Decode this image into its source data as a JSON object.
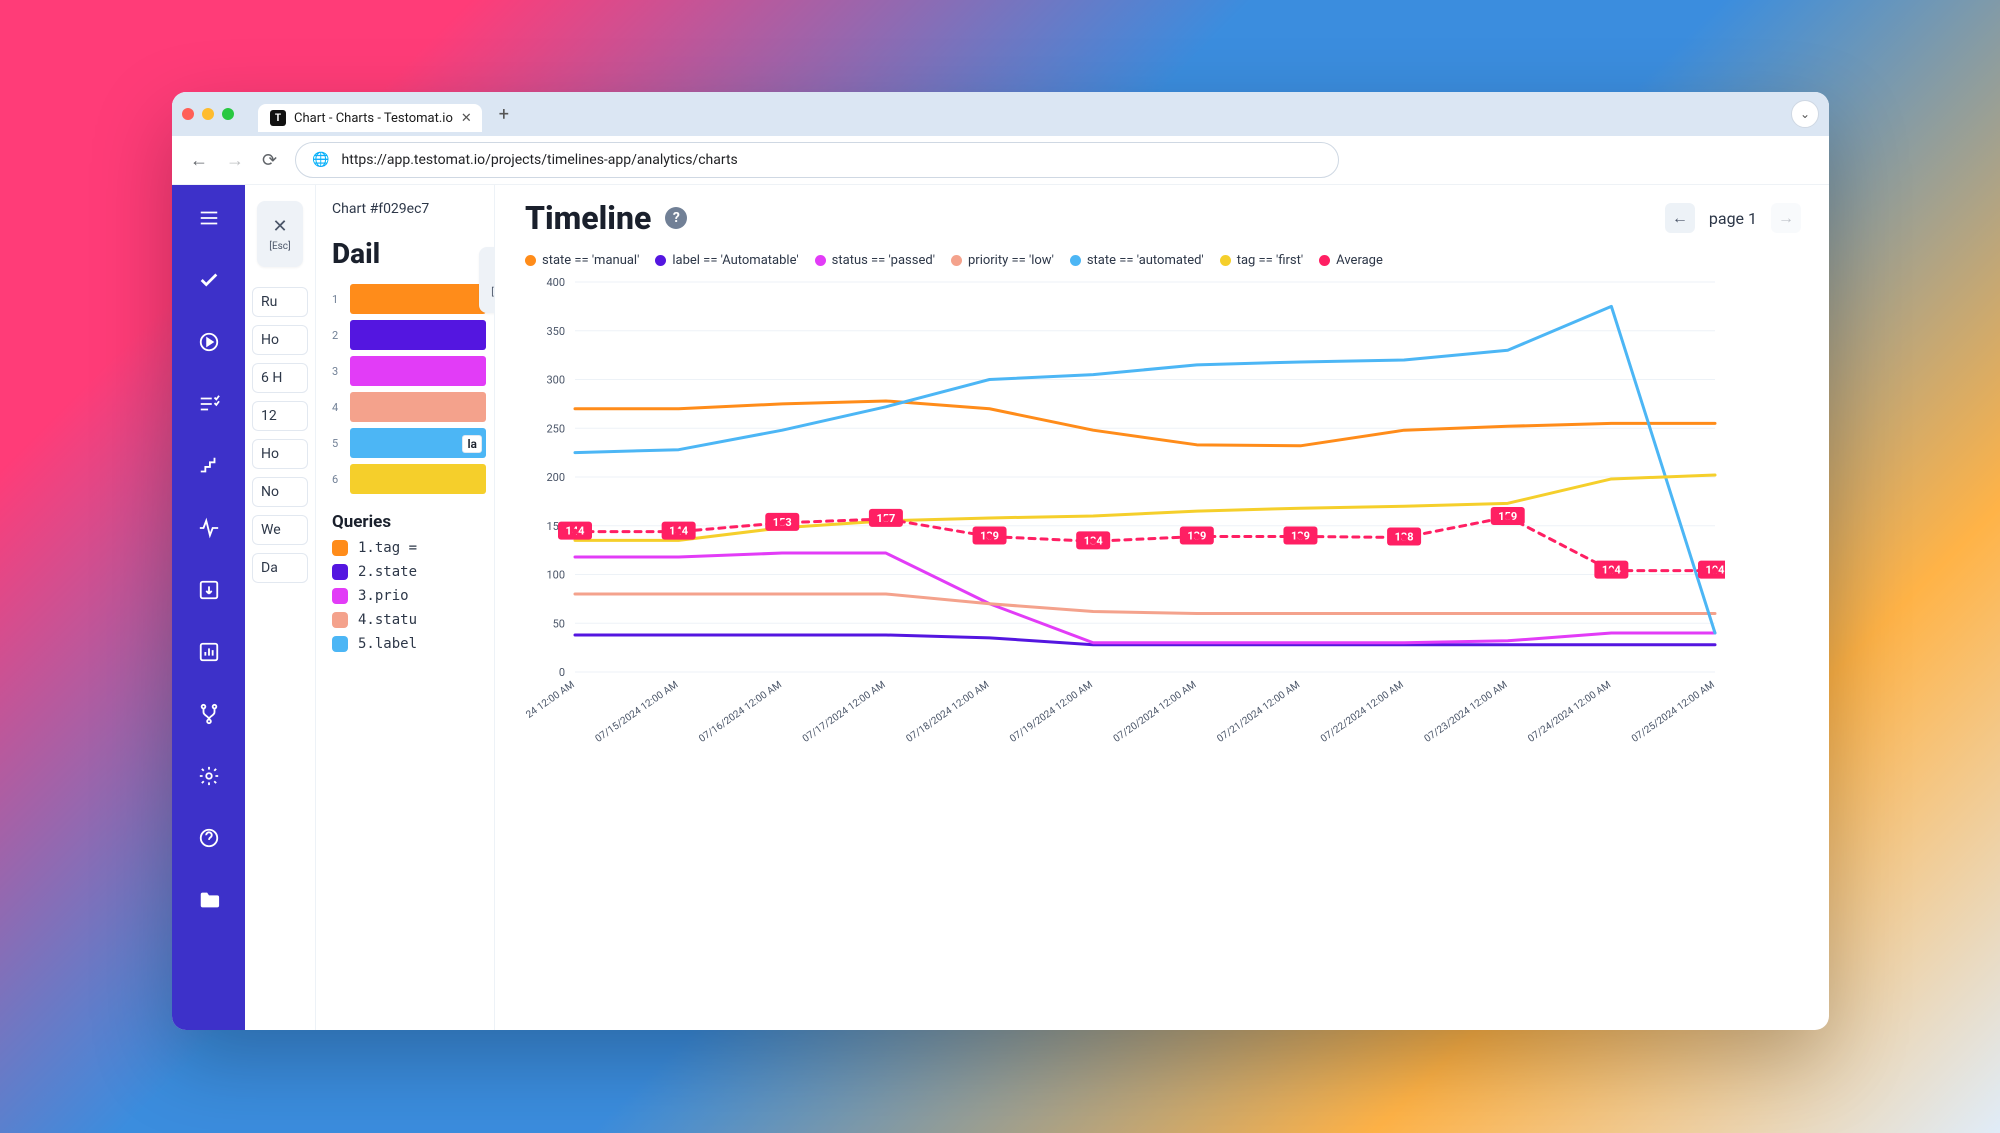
{
  "browser": {
    "tab_title": "Chart - Charts - Testomat.io",
    "url": "https://app.testomat.io/projects/timelines-app/analytics/charts"
  },
  "collapse": {
    "esc": "[Esc]"
  },
  "panel_chips": [
    "Ru",
    "Ho",
    "6 H",
    "12",
    "Ho",
    "No",
    "We",
    "Da"
  ],
  "mid": {
    "crumb": "Chart #f029ec7",
    "heading": "Dail",
    "swatches": [
      {
        "n": "1",
        "color": "#ff8c1a"
      },
      {
        "n": "2",
        "color": "#5416e0"
      },
      {
        "n": "3",
        "color": "#e23cf7"
      },
      {
        "n": "4",
        "color": "#f4a28c"
      },
      {
        "n": "5",
        "color": "#4cb6f5",
        "tag": "la"
      },
      {
        "n": "6",
        "color": "#f5cf2b"
      }
    ],
    "queries_title": "Queries",
    "queries": [
      {
        "color": "#ff8c1a",
        "text": "1.tag ="
      },
      {
        "color": "#5416e0",
        "text": "2.state"
      },
      {
        "color": "#e23cf7",
        "text": "3.prio"
      },
      {
        "color": "#f4a28c",
        "text": "4.statu"
      },
      {
        "color": "#4cb6f5",
        "text": "5.label"
      }
    ]
  },
  "header": {
    "title": "Timeline",
    "page": "page 1"
  },
  "legend": [
    {
      "color": "#ff8c1a",
      "label": "state == 'manual'"
    },
    {
      "color": "#5416e0",
      "label": "label == 'Automatable'"
    },
    {
      "color": "#e23cf7",
      "label": "status == 'passed'"
    },
    {
      "color": "#f4a28c",
      "label": "priority == 'low'"
    },
    {
      "color": "#4cb6f5",
      "label": "state == 'automated'"
    },
    {
      "color": "#f5cf2b",
      "label": "tag == 'first'"
    },
    {
      "color": "#ff1f63",
      "label": "Average"
    }
  ],
  "chart_data": {
    "type": "line",
    "title": "Timeline",
    "xlabel": "",
    "ylabel": "",
    "ylim": [
      0,
      400
    ],
    "y_ticks": [
      0,
      50,
      100,
      150,
      200,
      250,
      300,
      350,
      400
    ],
    "categories": [
      "24 12:00 AM",
      "07/15/2024 12:00 AM",
      "07/16/2024 12:00 AM",
      "07/17/2024 12:00 AM",
      "07/18/2024 12:00 AM",
      "07/19/2024 12:00 AM",
      "07/20/2024 12:00 AM",
      "07/21/2024 12:00 AM",
      "07/22/2024 12:00 AM",
      "07/23/2024 12:00 AM",
      "07/24/2024 12:00 AM",
      "07/25/2024 12:00 AM"
    ],
    "series": [
      {
        "name": "state == 'manual'",
        "color": "#ff8c1a",
        "values": [
          270,
          270,
          275,
          278,
          270,
          248,
          233,
          232,
          248,
          252,
          255,
          255
        ]
      },
      {
        "name": "label == 'Automatable'",
        "color": "#5416e0",
        "values": [
          38,
          38,
          38,
          38,
          35,
          28,
          28,
          28,
          28,
          28,
          28,
          28
        ]
      },
      {
        "name": "status == 'passed'",
        "color": "#e23cf7",
        "values": [
          118,
          118,
          122,
          122,
          70,
          30,
          30,
          30,
          30,
          32,
          40,
          40
        ]
      },
      {
        "name": "priority == 'low'",
        "color": "#f4a28c",
        "values": [
          80,
          80,
          80,
          80,
          70,
          62,
          60,
          60,
          60,
          60,
          60,
          60
        ]
      },
      {
        "name": "state == 'automated'",
        "color": "#4cb6f5",
        "values": [
          225,
          228,
          248,
          272,
          300,
          305,
          315,
          318,
          320,
          330,
          375,
          40
        ]
      },
      {
        "name": "tag == 'first'",
        "color": "#f5cf2b",
        "values": [
          135,
          135,
          148,
          155,
          158,
          160,
          165,
          168,
          170,
          173,
          198,
          202
        ]
      },
      {
        "name": "Average",
        "color": "#ff1f63",
        "dashed": true,
        "values": [
          144,
          144,
          153,
          157,
          139,
          134,
          139,
          139,
          138,
          159,
          104,
          104
        ],
        "labels": [
          144,
          144,
          153,
          157,
          139,
          134,
          139,
          139,
          138,
          159,
          104,
          104
        ]
      }
    ]
  }
}
